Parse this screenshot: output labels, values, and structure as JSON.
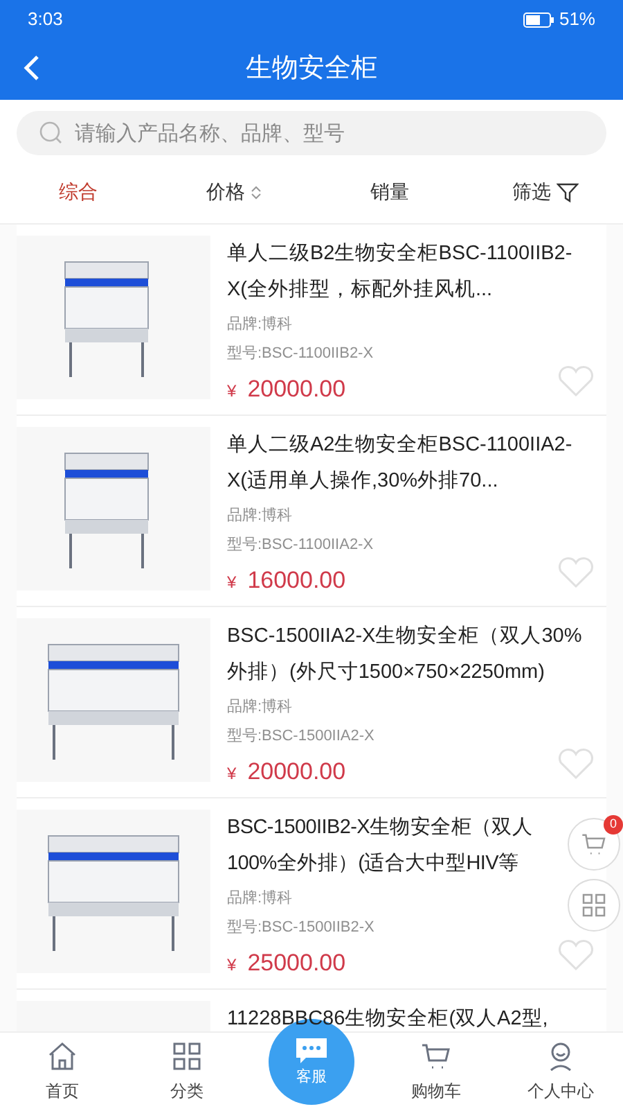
{
  "status_bar": {
    "time": "3:03",
    "battery": "51%"
  },
  "header": {
    "title": "生物安全柜"
  },
  "search": {
    "placeholder": "请输入产品名称、品牌、型号"
  },
  "sort_tabs": [
    {
      "label": "综合",
      "selected": true,
      "kind": "plain"
    },
    {
      "label": "价格",
      "selected": false,
      "kind": "sort"
    },
    {
      "label": "销量",
      "selected": false,
      "kind": "plain"
    },
    {
      "label": "筛选",
      "selected": false,
      "kind": "filter"
    }
  ],
  "products": [
    {
      "title": "单人二级B2生物安全柜BSC-1100IIB2-X(全外排型，标配外挂风机...",
      "brand": "品牌:博科",
      "model": "型号:BSC-1100IIB2-X",
      "currency": "¥",
      "price": "20000.00",
      "favorite": false
    },
    {
      "title": "单人二级A2生物安全柜BSC-1100IIA2-X(适用单人操作,30%外排70...",
      "brand": "品牌:博科",
      "model": "型号:BSC-1100IIA2-X",
      "currency": "¥",
      "price": "16000.00",
      "favorite": false
    },
    {
      "title": "BSC-1500IIA2-X生物安全柜（双人30%外排）(外尺寸1500×750×2250mm)",
      "brand": "品牌:博科",
      "model": "型号:BSC-1500IIA2-X",
      "currency": "¥",
      "price": "20000.00",
      "favorite": false
    },
    {
      "title": "BSC-1500IIB2-X生物安全柜（双人100%全外排）(适合大中型HIV等",
      "brand": "品牌:博科",
      "model": "型号:BSC-1500IIB2-X",
      "currency": "¥",
      "price": "25000.00",
      "favorite": false
    },
    {
      "title": "11228BBC86生物安全柜(双人A2型,"
    }
  ],
  "cart_badge": "0",
  "bottom_nav": [
    {
      "label": "首页",
      "kind": "home",
      "selected": false
    },
    {
      "label": "分类",
      "kind": "grid",
      "selected": false
    },
    {
      "label": "客服",
      "kind": "chat",
      "selected": false
    },
    {
      "label": "购物车",
      "kind": "cart",
      "selected": false
    },
    {
      "label": "个人中心",
      "kind": "user",
      "selected": false
    }
  ]
}
